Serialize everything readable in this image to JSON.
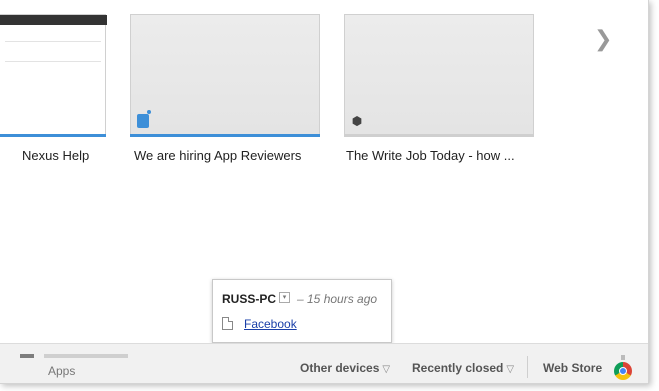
{
  "tiles": [
    {
      "title": "Nexus Help",
      "bar_color": "#3d8fd8"
    },
    {
      "title": "We are hiring App Reviewers",
      "bar_color": "#3d8fd8"
    },
    {
      "title": "The Write Job Today - how ...",
      "bar_color": "#cfcfcf"
    }
  ],
  "nav": {
    "next_glyph": "❯"
  },
  "popup": {
    "device": "RUSS-PC",
    "dropdown_glyph": "▾",
    "time": "– 15 hours ago",
    "link": "Facebook"
  },
  "bottom": {
    "apps_label": "Apps",
    "other_devices": "Other devices",
    "recently_closed": "Recently closed",
    "web_store": "Web Store",
    "triangle": "▽"
  }
}
